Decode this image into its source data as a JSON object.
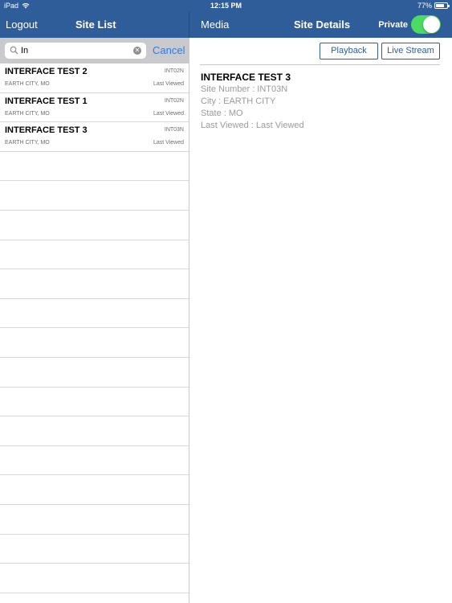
{
  "status_bar": {
    "device": "iPad",
    "time": "12:15 PM",
    "battery": "77%",
    "battery_level": 0.77
  },
  "left_nav": {
    "logout_label": "Logout",
    "title": "Site List"
  },
  "right_nav": {
    "media_label": "Media",
    "title": "Site Details",
    "private_label": "Private",
    "private_on": true
  },
  "search": {
    "value": "In",
    "cancel_label": "Cancel"
  },
  "sites": [
    {
      "name": "INTERFACE TEST 2",
      "code": "INT02N",
      "location": "EARTH CITY, MO",
      "last_viewed": "Last Viewed"
    },
    {
      "name": "INTERFACE TEST 1",
      "code": "INT02N",
      "location": "EARTH CITY, MO",
      "last_viewed": "Last Viewed"
    },
    {
      "name": "INTERFACE TEST 3",
      "code": "INT03N",
      "location": "EARTH CITY, MO",
      "last_viewed": "Last Viewed"
    }
  ],
  "details": {
    "playback_label": "Playback",
    "live_stream_label": "Live Stream",
    "title": "INTERFACE TEST 3",
    "site_number": "Site Number : INT03N",
    "city": "City : EARTH CITY",
    "state": "State : MO",
    "last_viewed": "Last Viewed : Last Viewed"
  },
  "colors": {
    "nav_blue": "#2f5d99",
    "toggle_green": "#4cd964",
    "link_blue": "#2f7de1"
  }
}
